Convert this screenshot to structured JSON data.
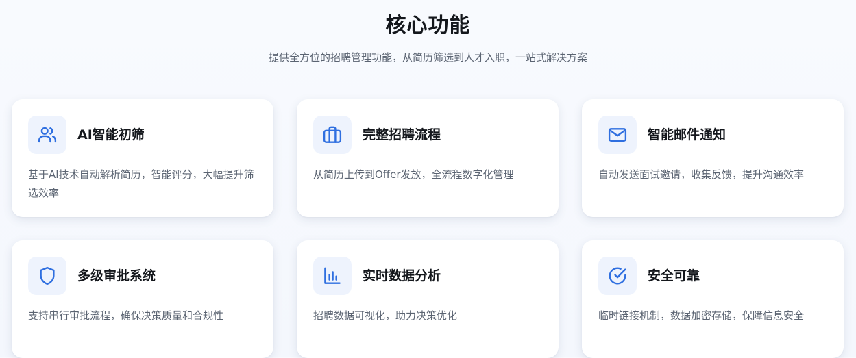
{
  "section": {
    "title": "核心功能",
    "subtitle": "提供全方位的招聘管理功能，从简历筛选到人才入职，一站式解决方案"
  },
  "accent_color": "#2f6fe0",
  "features": [
    {
      "icon": "users-icon",
      "title": "AI智能初筛",
      "description": "基于AI技术自动解析简历，智能评分，大幅提升筛选效率"
    },
    {
      "icon": "briefcase-icon",
      "title": "完整招聘流程",
      "description": "从简历上传到Offer发放，全流程数字化管理"
    },
    {
      "icon": "mail-icon",
      "title": "智能邮件通知",
      "description": "自动发送面试邀请，收集反馈，提升沟通效率"
    },
    {
      "icon": "shield-icon",
      "title": "多级审批系统",
      "description": "支持串行审批流程，确保决策质量和合规性"
    },
    {
      "icon": "bar-chart-icon",
      "title": "实时数据分析",
      "description": "招聘数据可视化，助力决策优化"
    },
    {
      "icon": "check-circle-icon",
      "title": "安全可靠",
      "description": "临时链接机制，数据加密存储，保障信息安全"
    }
  ]
}
